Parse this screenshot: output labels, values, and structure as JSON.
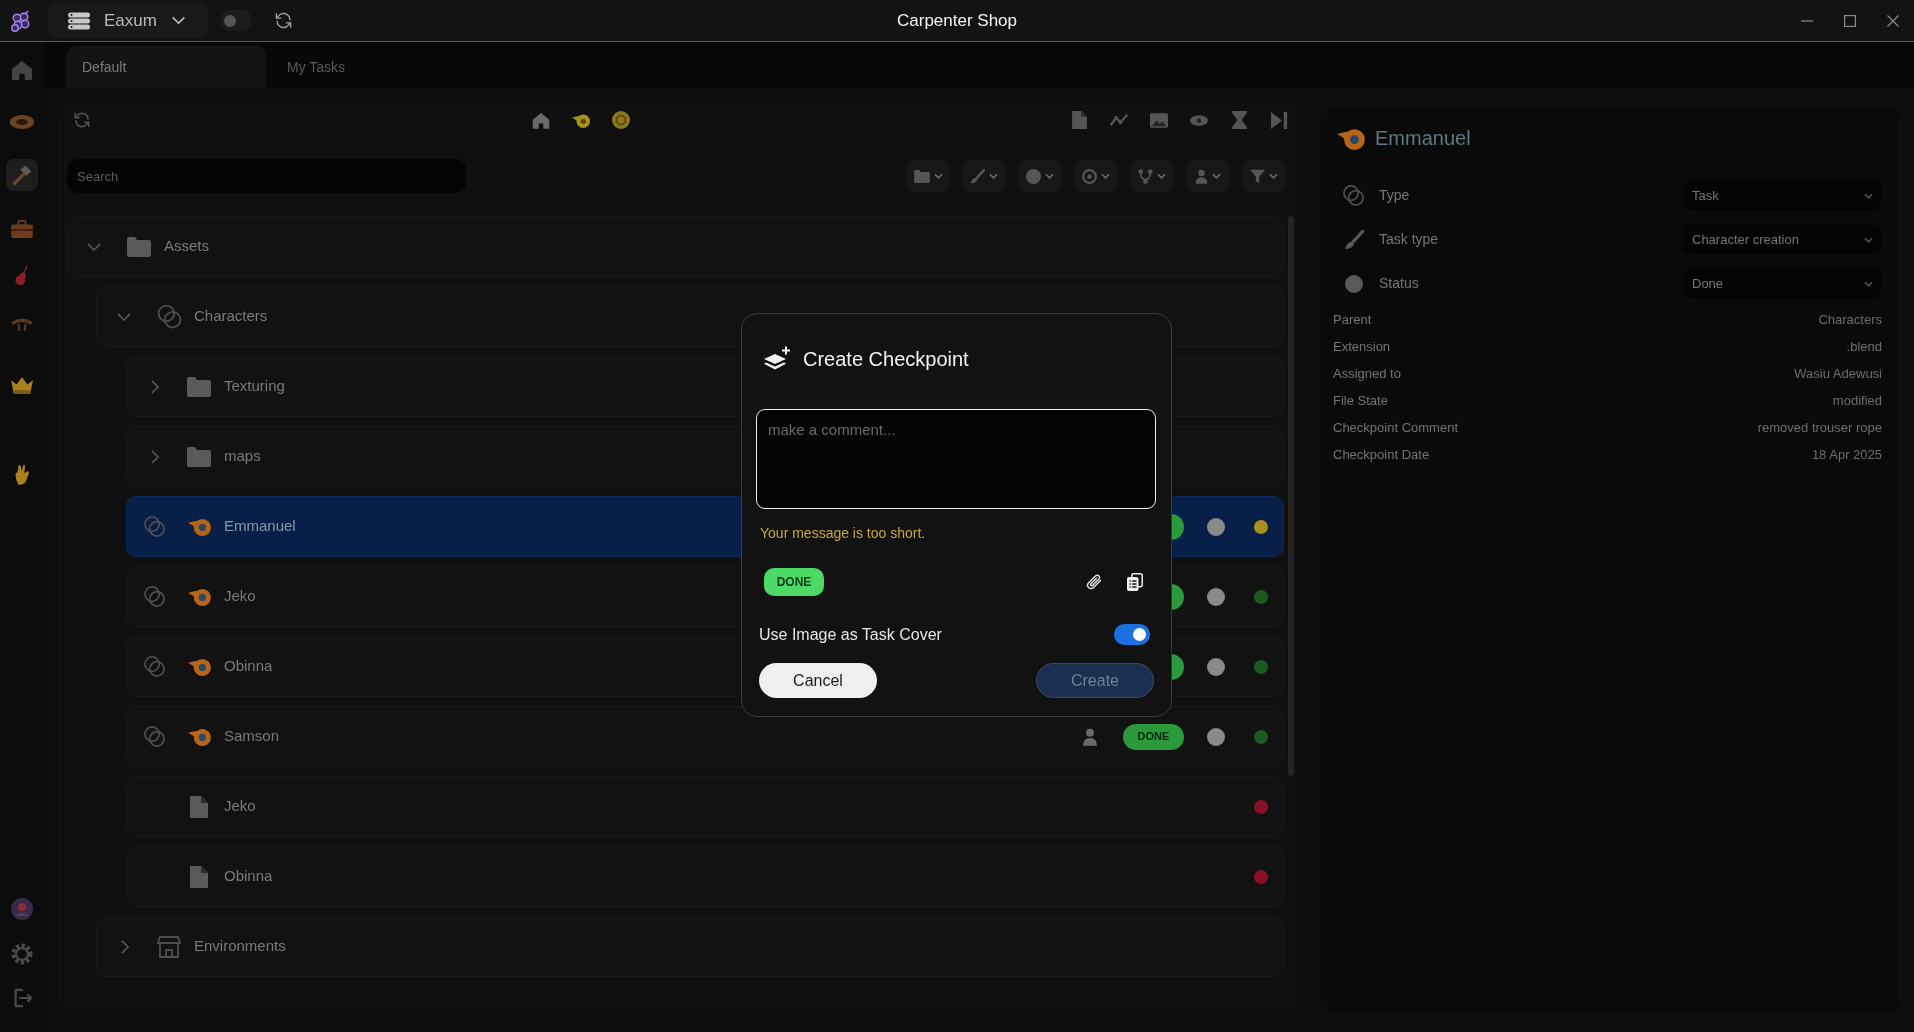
{
  "window": {
    "title": "Carpenter Shop"
  },
  "title_bar": {
    "workspace": "Eaxum",
    "sync_switch": {
      "on": false
    }
  },
  "nav_rail": {
    "items": [
      {
        "selected": false
      },
      {
        "selected": false
      },
      {
        "selected": true
      },
      {
        "selected": false
      },
      {
        "selected": false
      },
      {
        "selected": false
      },
      {
        "selected": false
      },
      {
        "selected": false
      }
    ]
  },
  "tabs": [
    {
      "label": "Default",
      "selected": true
    },
    {
      "label": "My Tasks",
      "selected": false
    }
  ],
  "search": {
    "placeholder": "Search"
  },
  "tree": [
    {
      "label": "Assets",
      "kind": "folder",
      "expanded": true,
      "selected": false,
      "children": [
        {
          "label": "Characters",
          "kind": "category",
          "expanded": true,
          "selected": false,
          "children": [
            {
              "label": "Texturing",
              "kind": "folder",
              "expanded": false,
              "selected": false
            },
            {
              "label": "maps",
              "kind": "folder",
              "expanded": false,
              "selected": false
            },
            {
              "label": "Emmanuel",
              "kind": "task",
              "selected": true,
              "badge": true,
              "color": "#a8901e"
            },
            {
              "label": "Jeko",
              "kind": "task",
              "selected": false,
              "badge": true,
              "color": "#1d5a22"
            },
            {
              "label": "Obinna",
              "kind": "task",
              "selected": false,
              "badge": true,
              "color": "#1d5a22"
            },
            {
              "label": "Samson",
              "kind": "task",
              "selected": false,
              "badge": true,
              "badge_label": "DONE",
              "user_icon": true,
              "color": "#1d5a22"
            },
            {
              "label": "Jeko",
              "kind": "file",
              "selected": false,
              "color": "#8a1028"
            },
            {
              "label": "Obinna",
              "kind": "file",
              "selected": false,
              "color": "#8a1028"
            }
          ]
        },
        {
          "label": "Environments",
          "kind": "category",
          "expanded": false,
          "selected": false
        }
      ]
    }
  ],
  "details": {
    "title": "Emmanuel",
    "fields": [
      {
        "label": "Type",
        "value": "Task"
      },
      {
        "label": "Task type",
        "value": "Character creation"
      },
      {
        "label": "Status",
        "value": "Done"
      }
    ],
    "properties": [
      {
        "label": "Parent",
        "value": "Characters"
      },
      {
        "label": "Extension",
        "value": ".blend"
      },
      {
        "label": "Assigned to",
        "value": "Wasiu Adewusi"
      },
      {
        "label": "File State",
        "value": "modified"
      },
      {
        "label": "Checkpoint Comment",
        "value": "removed trouser rope"
      },
      {
        "label": "Checkpoint Date",
        "value": "18 Apr 2025"
      }
    ]
  },
  "dialog": {
    "title": "Create Checkpoint",
    "comment": {
      "placeholder": "make a comment..."
    },
    "error": "Your message is too short.",
    "status_badge": "DONE",
    "cover_toggle": {
      "label": "Use Image as Task Cover",
      "on": true
    },
    "buttons": [
      {
        "label": "Cancel",
        "kind": "secondary",
        "disabled": false
      },
      {
        "label": "Create",
        "kind": "primary",
        "disabled": true
      }
    ]
  }
}
